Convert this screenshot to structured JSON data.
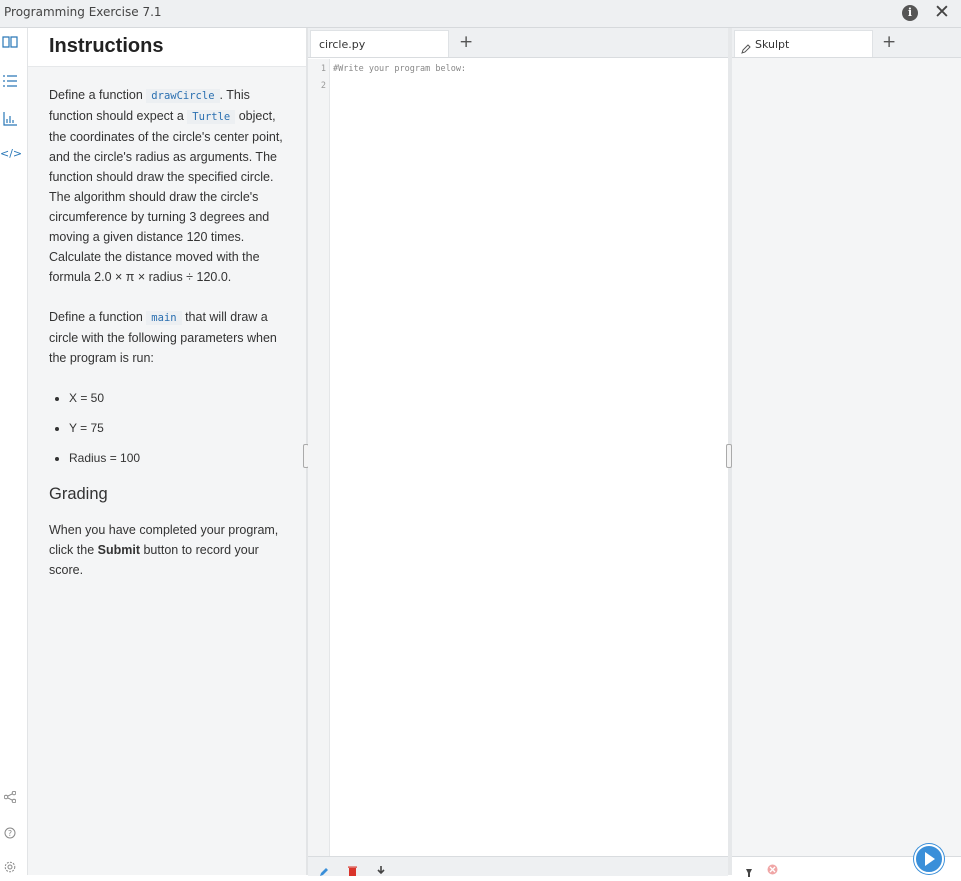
{
  "window": {
    "title": "Programming Exercise 7.1"
  },
  "instructions": {
    "title": "Instructions",
    "p1": [
      "Define a function ",
      "drawCircle",
      ". This function should expect a ",
      "Turtle",
      " object, the coordinates of the circle's center point, and the circle's radius as arguments. The function should draw the specified circle. The algorithm should draw the circle's circumference by turning 3 degrees and moving a given distance 120 times. Calculate the distance moved with the formula 2.0 × π × radius ÷ 120.0."
    ],
    "p2": [
      "Define a function ",
      "main",
      " that will draw a circle with the following parameters when the program is run:"
    ],
    "bullets": [
      "X = 50",
      "Y = 75",
      "Radius = 100"
    ],
    "grading_title": "Grading",
    "p3": [
      "When you have completed your program, click the ",
      "Submit",
      " button to record your score."
    ]
  },
  "editor": {
    "tab_label": "circle.py",
    "line_numbers": [
      "1",
      "2"
    ],
    "code_line_1": "#Write your program below:"
  },
  "output": {
    "tab_label": "Skulpt"
  },
  "icons": {
    "left_sidebar_top": [
      "book-icon",
      "list-icon",
      "chart-icon",
      "code-icon"
    ],
    "left_sidebar_bottom": [
      "share-icon",
      "help-icon",
      "settings-icon"
    ],
    "editor_toolbar": [
      "pencil-icon",
      "trash-icon",
      "download-icon"
    ],
    "output_toolbar": [
      "pin-icon",
      "clear-icon"
    ]
  },
  "colors": {
    "accent": "#2a78b8",
    "run_button": "#3a8fd9",
    "delete": "#d9342b"
  }
}
